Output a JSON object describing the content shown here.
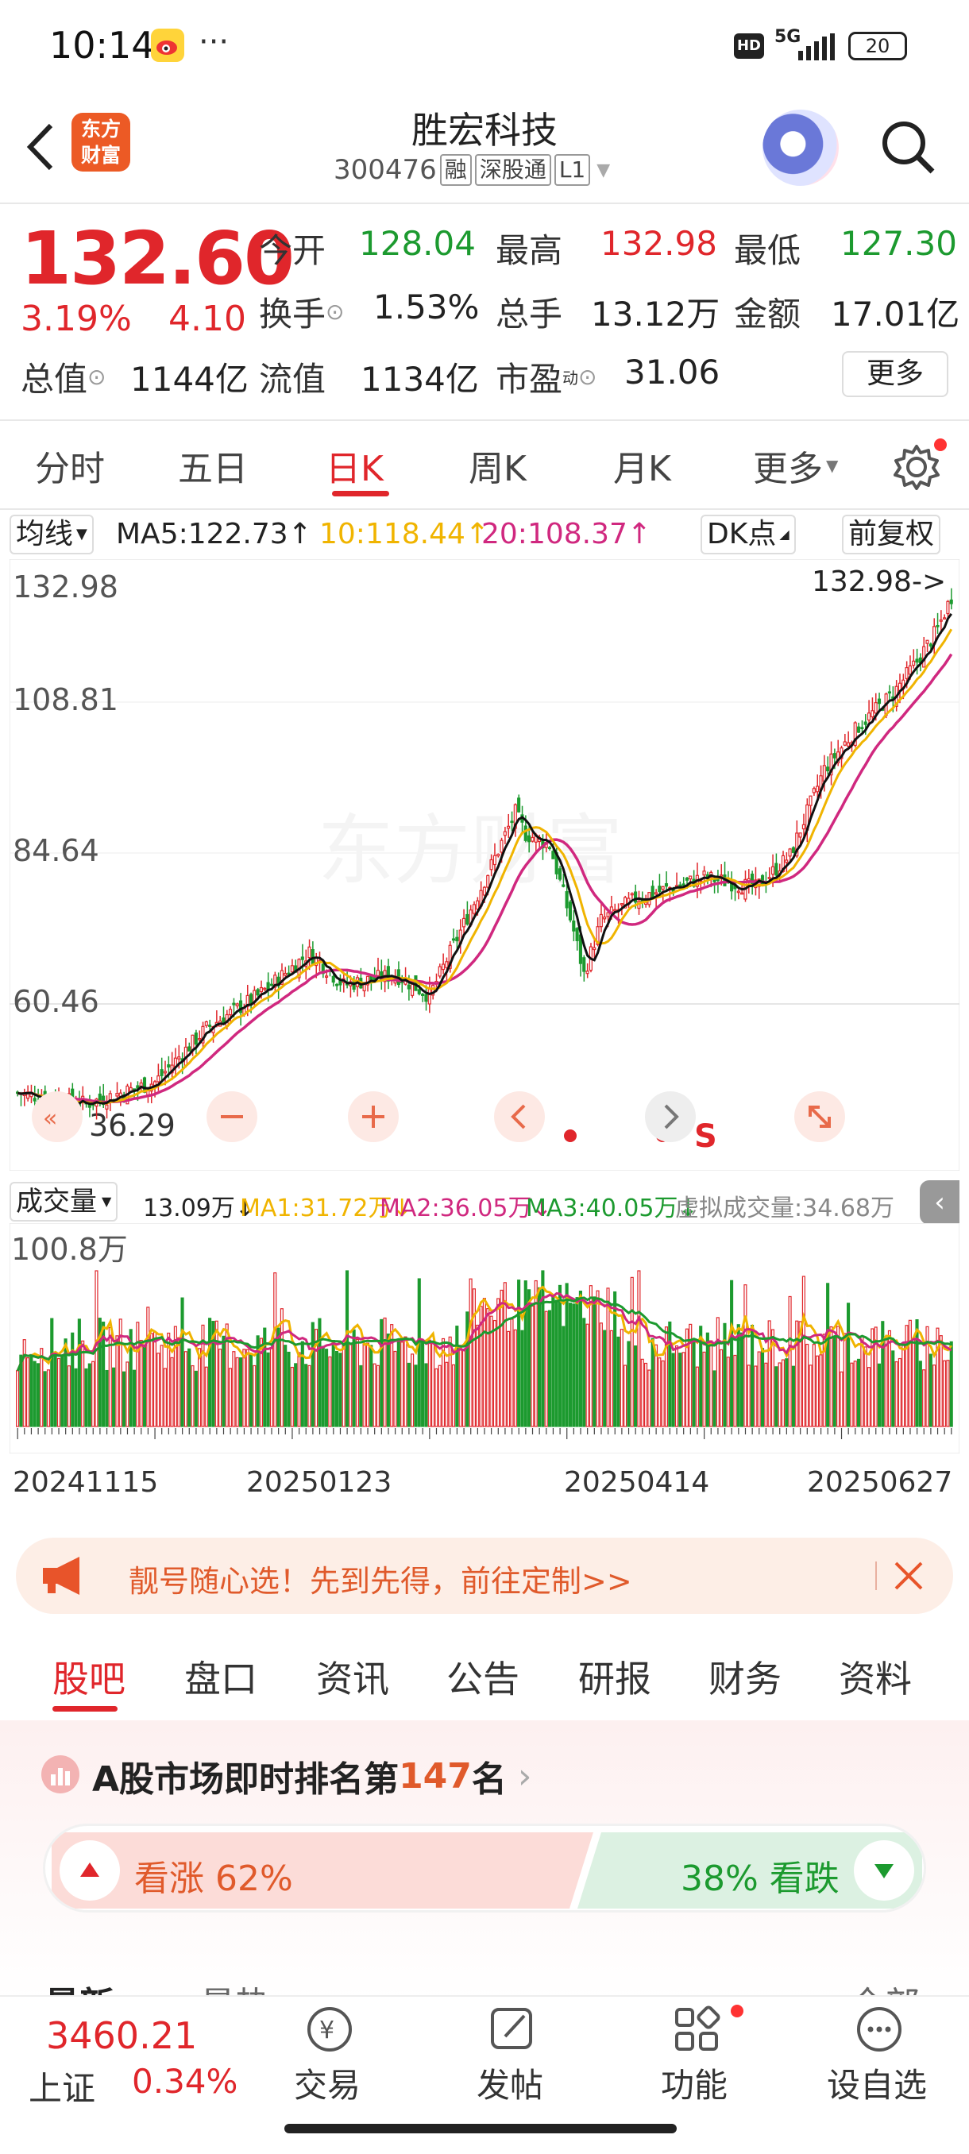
{
  "status_bar": {
    "time": "10:14",
    "dots": "···",
    "hd": "HD",
    "network": "5G",
    "battery": "20"
  },
  "header": {
    "logo_line1": "东方",
    "logo_line2": "财富",
    "stock_name": "胜宏科技",
    "stock_code": "300476",
    "tags": [
      "融",
      "深股通",
      "L1"
    ]
  },
  "quote": {
    "price": "132.60",
    "change_pct": "3.19%",
    "change": "4.10",
    "open_label": "今开",
    "open": "128.04",
    "high_label": "最高",
    "high": "132.98",
    "low_label": "最低",
    "low": "127.30",
    "turnover_label": "换手",
    "turnover": "1.53%",
    "volume_label": "总手",
    "volume": "13.12万",
    "amount_label": "金额",
    "amount": "17.01亿",
    "mktcap_label": "总值",
    "mktcap": "1144亿",
    "float_label": "流值",
    "float": "1134亿",
    "pe_label": "市盈",
    "pe_sup": "动",
    "pe": "31.06",
    "more": "更多"
  },
  "periods": [
    "分时",
    "五日",
    "日K",
    "周K",
    "月K",
    "更多"
  ],
  "active_period": "日K",
  "ma": {
    "selector": "均线",
    "ma5": "MA5:122.73↑",
    "ma10": "10:118.44↑",
    "ma20": "20:108.37↑",
    "dk": "DK点",
    "adjust": "前复权"
  },
  "kline": {
    "y_labels": [
      "132.98",
      "108.81",
      "84.64",
      "60.46",
      "36.29"
    ],
    "max_label": "132.98->",
    "watermark": "东方财富",
    "sell_mark": "S",
    "colors": {
      "up": "#e0262b",
      "down": "#1c9a2f",
      "ma5": "#111111",
      "ma10": "#f0b400",
      "ma20": "#d0287f"
    }
  },
  "volume_bar": {
    "selector": "成交量",
    "value": "13.09万↓",
    "ma1": "MA1:31.72万↓",
    "ma2": "MA2:36.05万↓",
    "ma3": "MA3:40.05万↓",
    "virtual": "虚拟成交量:34.68万",
    "y_label": "100.8万"
  },
  "dates": [
    "20241115",
    "20250123",
    "20250414",
    "20250627"
  ],
  "banner": {
    "text": "靓号随心选！先到先得，前往定制>>"
  },
  "content_tabs": [
    "股吧",
    "盘口",
    "资讯",
    "公告",
    "研报",
    "财务",
    "资料"
  ],
  "rank": {
    "prefix": "A股市场即时排名第",
    "number": "147",
    "suffix": "名",
    "bull": "看涨 62%",
    "bear": "38% 看跌"
  },
  "peek": {
    "left1": "最新",
    "left2": "最热",
    "right": "全部"
  },
  "bottom_nav": {
    "index_value": "3460.21",
    "index_name": "上证",
    "index_change": "0.34%",
    "items": [
      "交易",
      "发帖",
      "功能",
      "设自选"
    ]
  }
}
